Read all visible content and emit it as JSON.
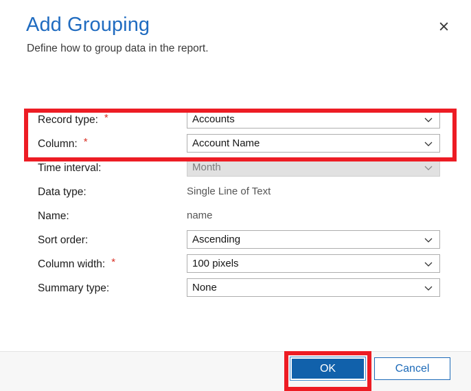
{
  "dialog": {
    "title": "Add Grouping",
    "subtitle": "Define how to group data in the report.",
    "close_icon": "close-icon"
  },
  "form": {
    "rows": [
      {
        "label": "Record type:",
        "required": true,
        "star": "*",
        "control": "select",
        "value": "Accounts",
        "disabled": false,
        "name": "record-type"
      },
      {
        "label": "Column:",
        "required": true,
        "star": "*",
        "control": "select",
        "value": "Account Name",
        "disabled": false,
        "name": "column"
      },
      {
        "label": "Time interval:",
        "required": false,
        "star": "",
        "control": "select",
        "value": "Month",
        "disabled": true,
        "name": "time-interval"
      },
      {
        "label": "Data type:",
        "required": false,
        "star": "",
        "control": "static",
        "value": "Single Line of Text",
        "disabled": false,
        "name": "data-type"
      },
      {
        "label": "Name:",
        "required": false,
        "star": "",
        "control": "static",
        "value": "name",
        "disabled": false,
        "name": "name"
      },
      {
        "label": "Sort order:",
        "required": false,
        "star": "",
        "control": "select",
        "value": "Ascending",
        "disabled": false,
        "name": "sort-order"
      },
      {
        "label": "Column width:",
        "required": true,
        "star": "*",
        "control": "select",
        "value": "100 pixels",
        "disabled": false,
        "name": "column-width"
      },
      {
        "label": "Summary type:",
        "required": false,
        "star": "",
        "control": "select",
        "value": "None",
        "disabled": false,
        "name": "summary-type"
      }
    ]
  },
  "footer": {
    "ok_label": "OK",
    "cancel_label": "Cancel"
  },
  "annotations": {
    "highlight_color": "#ed1c24",
    "boxes": [
      {
        "name": "required-fields-highlight"
      },
      {
        "name": "ok-button-highlight"
      }
    ]
  },
  "colors": {
    "title_blue": "#1f6bc0",
    "primary_button": "#1161ab",
    "link_blue": "#1b69b8",
    "required_red": "#d93025",
    "annotation_red": "#ed1c24"
  }
}
